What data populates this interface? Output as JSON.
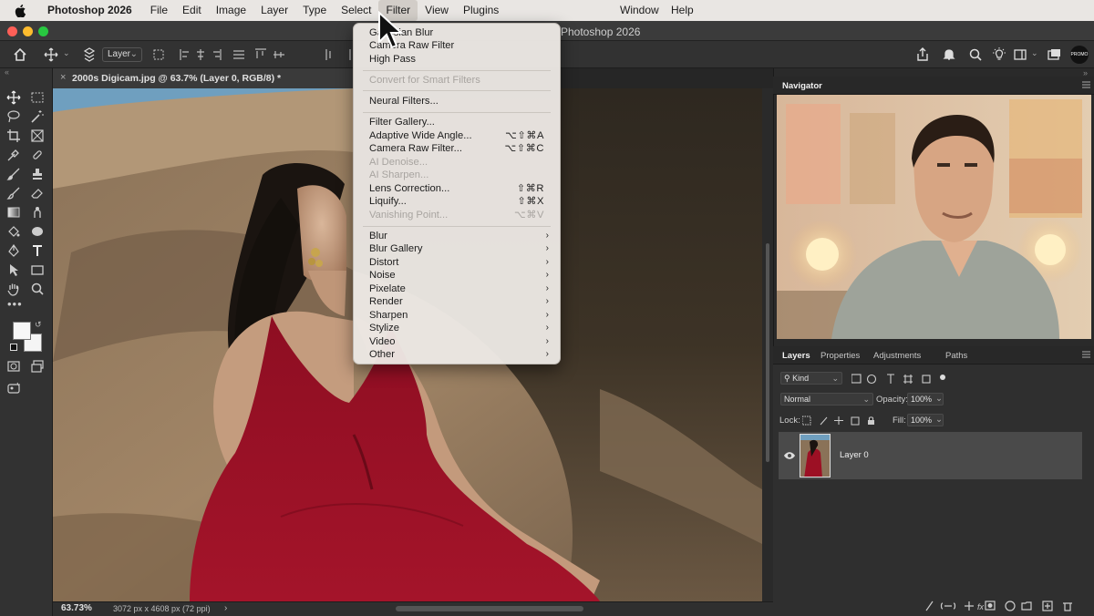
{
  "menubar": {
    "app": "Photoshop 2026",
    "left_items": [
      "File",
      "Edit",
      "Image",
      "Layer",
      "Type",
      "Select",
      "Filter",
      "View",
      "Plugins"
    ],
    "right_items": [
      "Window",
      "Help"
    ]
  },
  "window": {
    "title": "Photoshop 2026"
  },
  "options_bar": {
    "layer_select": "Layer",
    "avatar_text": "PROMO"
  },
  "document": {
    "tab_name": "2000s Digicam.jpg @ 63.7% (Layer 0, RGB/8) *",
    "close_glyph": "×"
  },
  "status": {
    "zoom": "63.73%",
    "dimensions": "3072 px x 4608 px (72 ppi)",
    "arrow": "›"
  },
  "filter_menu": {
    "items": [
      {
        "label": "Gaussian Blur",
        "shortcut": "",
        "disabled": false
      },
      {
        "label": "Camera Raw Filter",
        "shortcut": "",
        "disabled": false
      },
      {
        "label": "High Pass",
        "shortcut": "",
        "disabled": false
      },
      {
        "label": "Convert for Smart Filters",
        "shortcut": "",
        "disabled": true
      },
      {
        "label": "Neural Filters...",
        "shortcut": "",
        "disabled": false
      },
      {
        "label": "Filter Gallery...",
        "shortcut": "",
        "disabled": false
      },
      {
        "label": "Adaptive Wide Angle...",
        "shortcut": "⌥⇧⌘A",
        "disabled": false
      },
      {
        "label": "Camera Raw Filter...",
        "shortcut": "⌥⇧⌘C",
        "disabled": false
      },
      {
        "label": "AI Denoise...",
        "shortcut": "",
        "disabled": true
      },
      {
        "label": "AI Sharpen...",
        "shortcut": "",
        "disabled": true
      },
      {
        "label": "Lens Correction...",
        "shortcut": "⇧⌘R",
        "disabled": false
      },
      {
        "label": "Liquify...",
        "shortcut": "⇧⌘X",
        "disabled": false
      },
      {
        "label": "Vanishing Point...",
        "shortcut": "⌥⌘V",
        "disabled": true
      },
      {
        "label": "Blur",
        "submenu": true
      },
      {
        "label": "Blur Gallery",
        "submenu": true
      },
      {
        "label": "Distort",
        "submenu": true
      },
      {
        "label": "Noise",
        "submenu": true
      },
      {
        "label": "Pixelate",
        "submenu": true
      },
      {
        "label": "Render",
        "submenu": true
      },
      {
        "label": "Sharpen",
        "submenu": true
      },
      {
        "label": "Stylize",
        "submenu": true
      },
      {
        "label": "Video",
        "submenu": true
      },
      {
        "label": "Other",
        "submenu": true
      }
    ],
    "chevron": "›"
  },
  "navigator": {
    "title": "Navigator"
  },
  "layers_panel": {
    "tabs": [
      "Layers",
      "Properties",
      "Adjustments",
      "Paths"
    ],
    "kind_filter": "Kind",
    "blend_mode": "Normal",
    "opacity_label": "Opacity:",
    "opacity_value": "100%",
    "lock_label": "Lock:",
    "fill_label": "Fill:",
    "fill_value": "100%",
    "layer_name": "Layer 0"
  },
  "colors": {
    "menubar_bg": "#e9e6e3",
    "panel_bg": "#2a2a2a",
    "dress_red": "#9c1024",
    "rock_tan": "#9a7f62",
    "sky_blue": "#6f9fbf"
  }
}
